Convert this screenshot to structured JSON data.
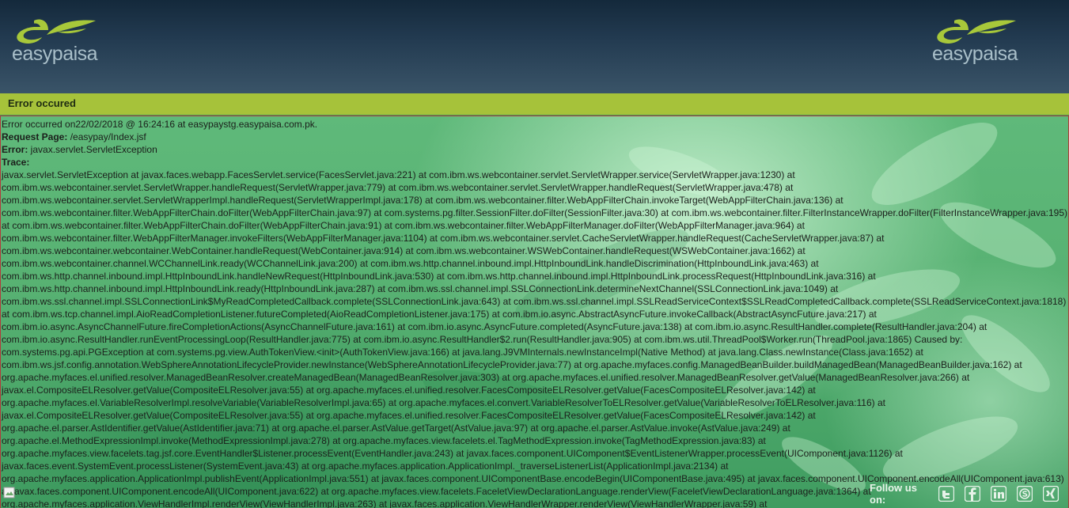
{
  "brand": {
    "logo_text": "easypaisa"
  },
  "title_bar": {
    "label": "Error occured"
  },
  "error": {
    "summary": "Error occurred on22/02/2018 @ 16:24:16 at easypaystg.easypaisa.com.pk.",
    "request_page_label": "Request Page:",
    "request_page_value": " /easypay/Index.jsf",
    "error_label": "Error:",
    "error_value": " javax.servlet.ServletException",
    "trace_label": "Trace:",
    "trace_lines": [
      "javax.servlet.ServletException at javax.faces.webapp.FacesServlet.service(FacesServlet.java:221) at com.ibm.ws.webcontainer.servlet.ServletWrapper.service(ServletWrapper.java:1230) at",
      "com.ibm.ws.webcontainer.servlet.ServletWrapper.handleRequest(ServletWrapper.java:779) at com.ibm.ws.webcontainer.servlet.ServletWrapper.handleRequest(ServletWrapper.java:478) at",
      "com.ibm.ws.webcontainer.servlet.ServletWrapperImpl.handleRequest(ServletWrapperImpl.java:178) at com.ibm.ws.webcontainer.filter.WebAppFilterChain.invokeTarget(WebAppFilterChain.java:136) at",
      "com.ibm.ws.webcontainer.filter.WebAppFilterChain.doFilter(WebAppFilterChain.java:97) at com.systems.pg.filter.SessionFilter.doFilter(SessionFilter.java:30) at com.ibm.ws.webcontainer.filter.FilterInstanceWrapper.doFilter(FilterInstanceWrapper.java:195)",
      "at com.ibm.ws.webcontainer.filter.WebAppFilterChain.doFilter(WebAppFilterChain.java:91) at com.ibm.ws.webcontainer.filter.WebAppFilterManager.doFilter(WebAppFilterManager.java:964) at",
      "com.ibm.ws.webcontainer.filter.WebAppFilterManager.invokeFilters(WebAppFilterManager.java:1104) at com.ibm.ws.webcontainer.servlet.CacheServletWrapper.handleRequest(CacheServletWrapper.java:87) at",
      "com.ibm.ws.webcontainer.webcontainer.WebContainer.handleRequest(WebContainer.java:914) at com.ibm.ws.webcontainer.WSWebContainer.handleRequest(WSWebContainer.java:1662) at",
      "com.ibm.ws.webcontainer.channel.WCChannelLink.ready(WCChannelLink.java:200) at com.ibm.ws.http.channel.inbound.impl.HttpInboundLink.handleDiscrimination(HttpInboundLink.java:463) at",
      "com.ibm.ws.http.channel.inbound.impl.HttpInboundLink.handleNewRequest(HttpInboundLink.java:530) at com.ibm.ws.http.channel.inbound.impl.HttpInboundLink.processRequest(HttpInboundLink.java:316) at",
      "com.ibm.ws.http.channel.inbound.impl.HttpInboundLink.ready(HttpInboundLink.java:287) at com.ibm.ws.ssl.channel.impl.SSLConnectionLink.determineNextChannel(SSLConnectionLink.java:1049) at",
      "com.ibm.ws.ssl.channel.impl.SSLConnectionLink$MyReadCompletedCallback.complete(SSLConnectionLink.java:643) at com.ibm.ws.ssl.channel.impl.SSLReadServiceContext$SSLReadCompletedCallback.complete(SSLReadServiceContext.java:1818)",
      "at com.ibm.ws.tcp.channel.impl.AioReadCompletionListener.futureCompleted(AioReadCompletionListener.java:175) at com.ibm.io.async.AbstractAsyncFuture.invokeCallback(AbstractAsyncFuture.java:217) at",
      "com.ibm.io.async.AsyncChannelFuture.fireCompletionActions(AsyncChannelFuture.java:161) at com.ibm.io.async.AsyncFuture.completed(AsyncFuture.java:138) at com.ibm.io.async.ResultHandler.complete(ResultHandler.java:204) at",
      "com.ibm.io.async.ResultHandler.runEventProcessingLoop(ResultHandler.java:775) at com.ibm.io.async.ResultHandler$2.run(ResultHandler.java:905) at com.ibm.ws.util.ThreadPool$Worker.run(ThreadPool.java:1865) Caused by:",
      "com.systems.pg.api.PGException at com.systems.pg.view.AuthTokenView.<init>(AuthTokenView.java:166) at java.lang.J9VMInternals.newInstanceImpl(Native Method) at java.lang.Class.newInstance(Class.java:1652) at",
      "com.ibm.ws.jsf.config.annotation.WebSphereAnnotationLifecycleProvider.newInstance(WebSphereAnnotationLifecycleProvider.java:77) at org.apache.myfaces.config.ManagedBeanBuilder.buildManagedBean(ManagedBeanBuilder.java:162) at",
      "org.apache.myfaces.el.unified.resolver.ManagedBeanResolver.createManagedBean(ManagedBeanResolver.java:303) at org.apache.myfaces.el.unified.resolver.ManagedBeanResolver.getValue(ManagedBeanResolver.java:266) at",
      "javax.el.CompositeELResolver.getValue(CompositeELResolver.java:55) at org.apache.myfaces.el.unified.resolver.FacesCompositeELResolver.getValue(FacesCompositeELResolver.java:142) at",
      "org.apache.myfaces.el.VariableResolverImpl.resolveVariable(VariableResolverImpl.java:65) at org.apache.myfaces.el.convert.VariableResolverToELResolver.getValue(VariableResolverToELResolver.java:116) at",
      "javax.el.CompositeELResolver.getValue(CompositeELResolver.java:55) at org.apache.myfaces.el.unified.resolver.FacesCompositeELResolver.getValue(FacesCompositeELResolver.java:142) at",
      "org.apache.el.parser.AstIdentifier.getValue(AstIdentifier.java:71) at org.apache.el.parser.AstValue.getTarget(AstValue.java:97) at org.apache.el.parser.AstValue.invoke(AstValue.java:249) at",
      "org.apache.el.MethodExpressionImpl.invoke(MethodExpressionImpl.java:278) at org.apache.myfaces.view.facelets.el.TagMethodExpression.invoke(TagMethodExpression.java:83) at",
      "org.apache.myfaces.view.facelets.tag.jsf.core.EventHandler$Listener.processEvent(EventHandler.java:243) at javax.faces.component.UIComponent$EventListenerWrapper.processEvent(UIComponent.java:1126) at",
      "javax.faces.event.SystemEvent.processListener(SystemEvent.java:43) at org.apache.myfaces.application.ApplicationImpl._traverseListenerList(ApplicationImpl.java:2134) at",
      "org.apache.myfaces.application.ApplicationImpl.publishEvent(ApplicationImpl.java:551) at javax.faces.component.UIComponentBase.encodeBegin(UIComponentBase.java:495) at javax.faces.component.UIComponent.encodeAll(UIComponent.java:613)",
      "at javax.faces.component.UIComponent.encodeAll(UIComponent.java:622) at org.apache.myfaces.view.facelets.FaceletViewDeclarationLanguage.renderView(FaceletViewDeclarationLanguage.java:1364) at",
      "org.apache.myfaces.application.ViewHandlerImpl.renderView(ViewHandlerImpl.java:263) at javax.faces.application.ViewHandlerWrapper.renderView(ViewHandlerWrapper.java:59) at"
    ]
  },
  "footer": {
    "follow_label": "Follow us on:",
    "social_icons": [
      "twitter-icon",
      "facebook-icon",
      "linkedin-icon",
      "skype-icon",
      "xing-icon"
    ]
  },
  "colors": {
    "header": "#1e3447",
    "bar": "#a6c23a",
    "border": "#b23a3a",
    "logo_green": "#a8c83a"
  }
}
